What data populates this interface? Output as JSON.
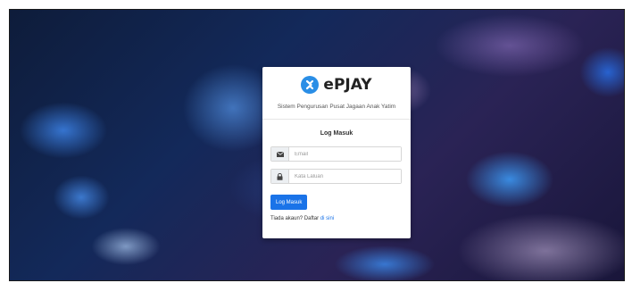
{
  "app": {
    "brand_name": "ePJAY",
    "subtitle": "Sistem Pengurusan Pusat Jagaan Anak Yatim",
    "accent_color": "#1a73e8",
    "logo_color": "#2a8ee6"
  },
  "login": {
    "heading": "Log Masuk",
    "email": {
      "placeholder": "Email",
      "value": "",
      "icon": "envelope-icon"
    },
    "password": {
      "placeholder": "Kata Laluan",
      "value": "",
      "icon": "lock-icon"
    },
    "submit_label": "Log Masuk",
    "signup_prompt": "Tiada akaun? Daftar",
    "signup_link": "di sini"
  }
}
